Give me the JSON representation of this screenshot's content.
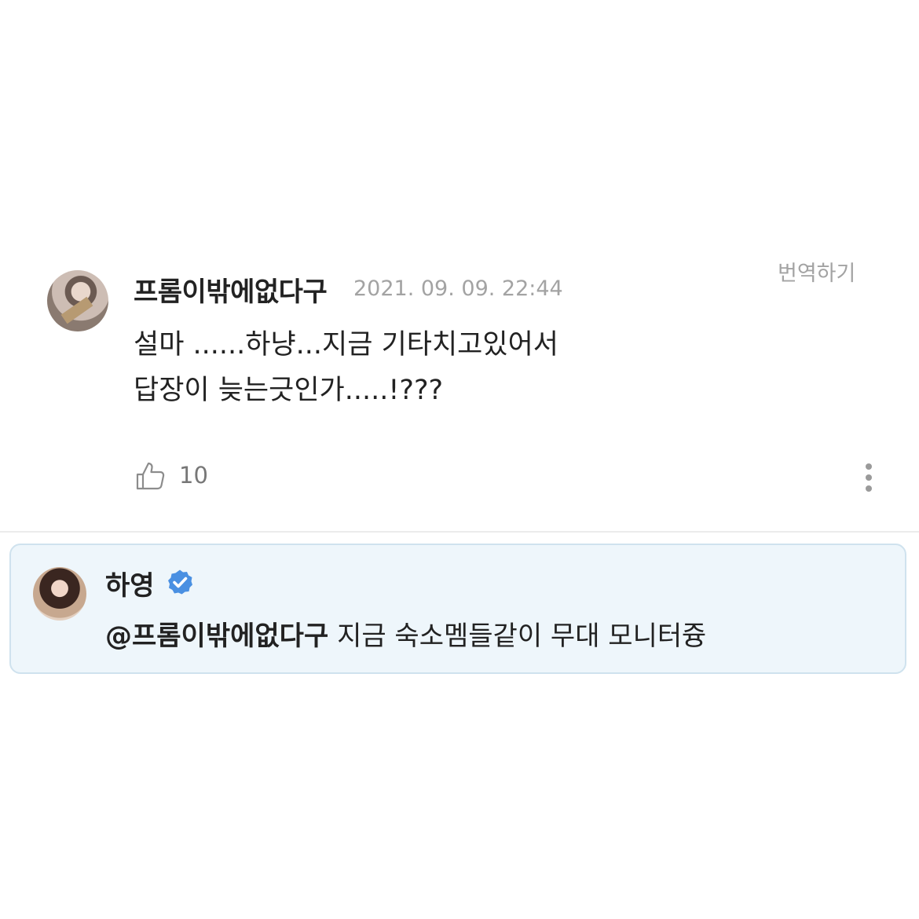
{
  "comment": {
    "username": "프롬이밖에없다구",
    "timestamp": "2021. 09. 09. 22:44",
    "translate_label": "번역하기",
    "text_lines": [
      "설마 ......하냥...지금 기타치고있어서",
      "답장이 늦는긋인가.....!???"
    ],
    "like_count": "10",
    "like_icon": "thumbs-up-icon",
    "more_icon": "more-vertical-icon"
  },
  "reply": {
    "name": "하영",
    "verified_icon": "verified-badge-icon",
    "mention": "@프롬이밖에없다구",
    "text": "지금 숙소멤들같이 무대 모니터즁"
  },
  "colors": {
    "reply_background": "#eef6fb",
    "reply_border": "#cfe2ee",
    "verified_blue": "#4a90e2",
    "muted_text": "#a3a3a3"
  }
}
